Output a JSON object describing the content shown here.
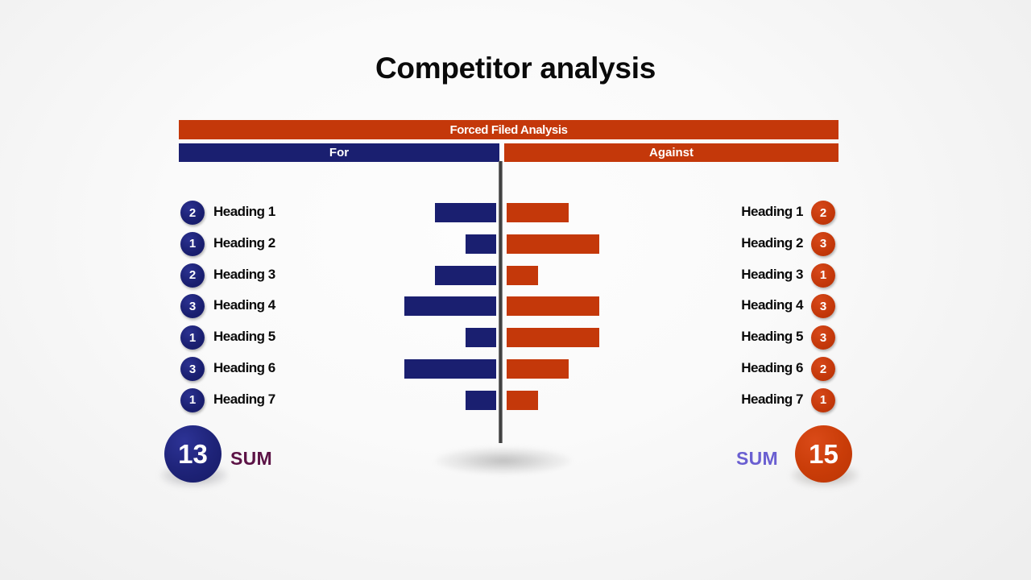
{
  "slide": {
    "title": "Competitor analysis",
    "background_color": "#f7f7f7"
  },
  "header": {
    "main_label": "Forced Filed Analysis",
    "for_label": "For",
    "against_label": "Against",
    "orange": "#c4380a",
    "blue": "#1a1f70"
  },
  "chart_data": {
    "type": "bar",
    "title": "Forced Filed Analysis",
    "subtitle": "Competitor analysis",
    "orientation": "horizontal-diverging",
    "categories": [
      "Heading 1",
      "Heading 2",
      "Heading 3",
      "Heading 4",
      "Heading 5",
      "Heading 6",
      "Heading 7"
    ],
    "series": [
      {
        "name": "For",
        "color": "#1a1f70",
        "direction": "left",
        "values": [
          2,
          1,
          2,
          3,
          1,
          3,
          1
        ],
        "total": 13
      },
      {
        "name": "Against",
        "color": "#c4380a",
        "direction": "right",
        "values": [
          2,
          3,
          1,
          3,
          3,
          2,
          1
        ],
        "total": 15
      }
    ],
    "xlabel": "",
    "ylabel": "",
    "xlim": [
      0,
      3
    ],
    "grid": false,
    "legend": "top"
  },
  "rows": [
    {
      "left_value": "2",
      "left_label": "Heading 1",
      "right_label": "Heading 1",
      "right_value": "2"
    },
    {
      "left_value": "1",
      "left_label": "Heading 2",
      "right_label": "Heading 2",
      "right_value": "3"
    },
    {
      "left_value": "2",
      "left_label": "Heading 3",
      "right_label": "Heading 3",
      "right_value": "1"
    },
    {
      "left_value": "3",
      "left_label": "Heading 4",
      "right_label": "Heading 4",
      "right_value": "3"
    },
    {
      "left_value": "1",
      "left_label": "Heading 5",
      "right_label": "Heading 5",
      "right_value": "3"
    },
    {
      "left_value": "3",
      "left_label": "Heading 6",
      "right_label": "Heading 6",
      "right_value": "2"
    },
    {
      "left_value": "1",
      "left_label": "Heading 7",
      "right_label": "Heading 7",
      "right_value": "1"
    }
  ],
  "summary": {
    "left_total": "13",
    "left_label": "SUM",
    "left_label_color": "#5c1346",
    "right_label": "SUM",
    "right_label_color": "#6a5fd1",
    "right_total": "15"
  }
}
